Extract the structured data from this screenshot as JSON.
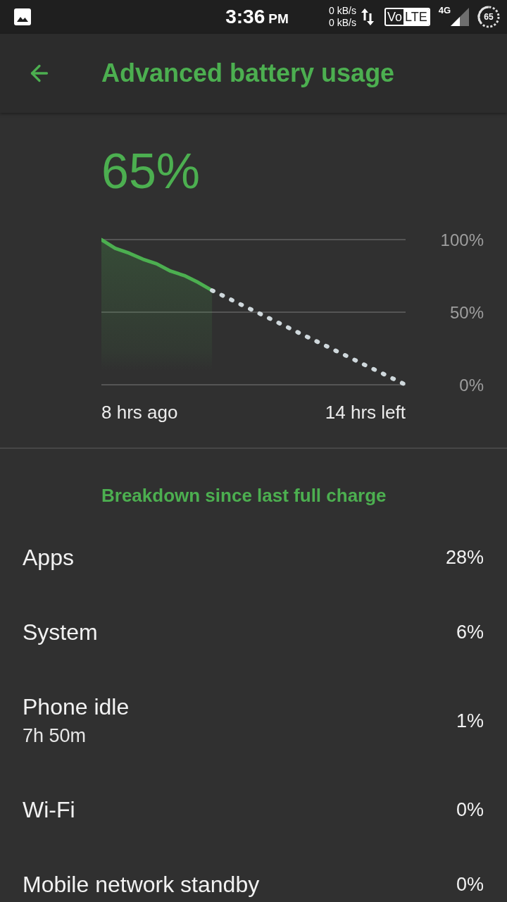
{
  "status_bar": {
    "time": "3:36",
    "ampm": "PM",
    "upload_speed": "0 kB/s",
    "download_speed": "0 kB/s",
    "volte": {
      "outlined": "Vo",
      "filled": "LTE"
    },
    "network_type": "4G",
    "battery": "65"
  },
  "toolbar": {
    "title": "Advanced battery usage"
  },
  "battery_level": "65%",
  "chart": {
    "start_label": "8 hrs ago",
    "end_label": "14 hrs left",
    "chart_data": {
      "type": "line",
      "categories": [
        null,
        null,
        null,
        null,
        null,
        null,
        null,
        null,
        null,
        null,
        null,
        null,
        null,
        null,
        null,
        null,
        null,
        null,
        null,
        null,
        null,
        null,
        null
      ],
      "series": [
        {
          "color": "#4caf50",
          "line_style": "solid",
          "values": [
            100,
            94,
            90.7,
            86.5,
            83.3,
            78.3,
            75.2,
            70.5,
            65,
            null,
            null,
            null,
            null,
            null,
            null,
            null,
            null,
            null,
            null,
            null,
            null,
            null,
            null
          ]
        },
        {
          "color": "#cfd8dc",
          "line_style": "dotted",
          "values": [
            null,
            null,
            null,
            null,
            null,
            null,
            null,
            null,
            65,
            60.4,
            55.7,
            51.1,
            46.4,
            41.8,
            37.1,
            32.5,
            27.9,
            23.2,
            18.6,
            13.9,
            9.3,
            4.6,
            0
          ]
        }
      ],
      "ylim": [
        0,
        100
      ],
      "yticks": [
        {
          "value": 0,
          "label": "0%"
        },
        {
          "value": 50,
          "label": "50%"
        },
        {
          "value": 100,
          "label": "100%"
        }
      ]
    }
  },
  "breakdown": {
    "title": "Breakdown since last full charge",
    "items": [
      {
        "label": "Apps",
        "value": "28%"
      },
      {
        "label": "System",
        "value": "6%"
      },
      {
        "label": "Phone idle",
        "detail": "7h 50m",
        "value": "1%"
      },
      {
        "label": "Wi-Fi",
        "value": "0%"
      },
      {
        "label": "Mobile network standby",
        "value": "0%"
      }
    ]
  }
}
